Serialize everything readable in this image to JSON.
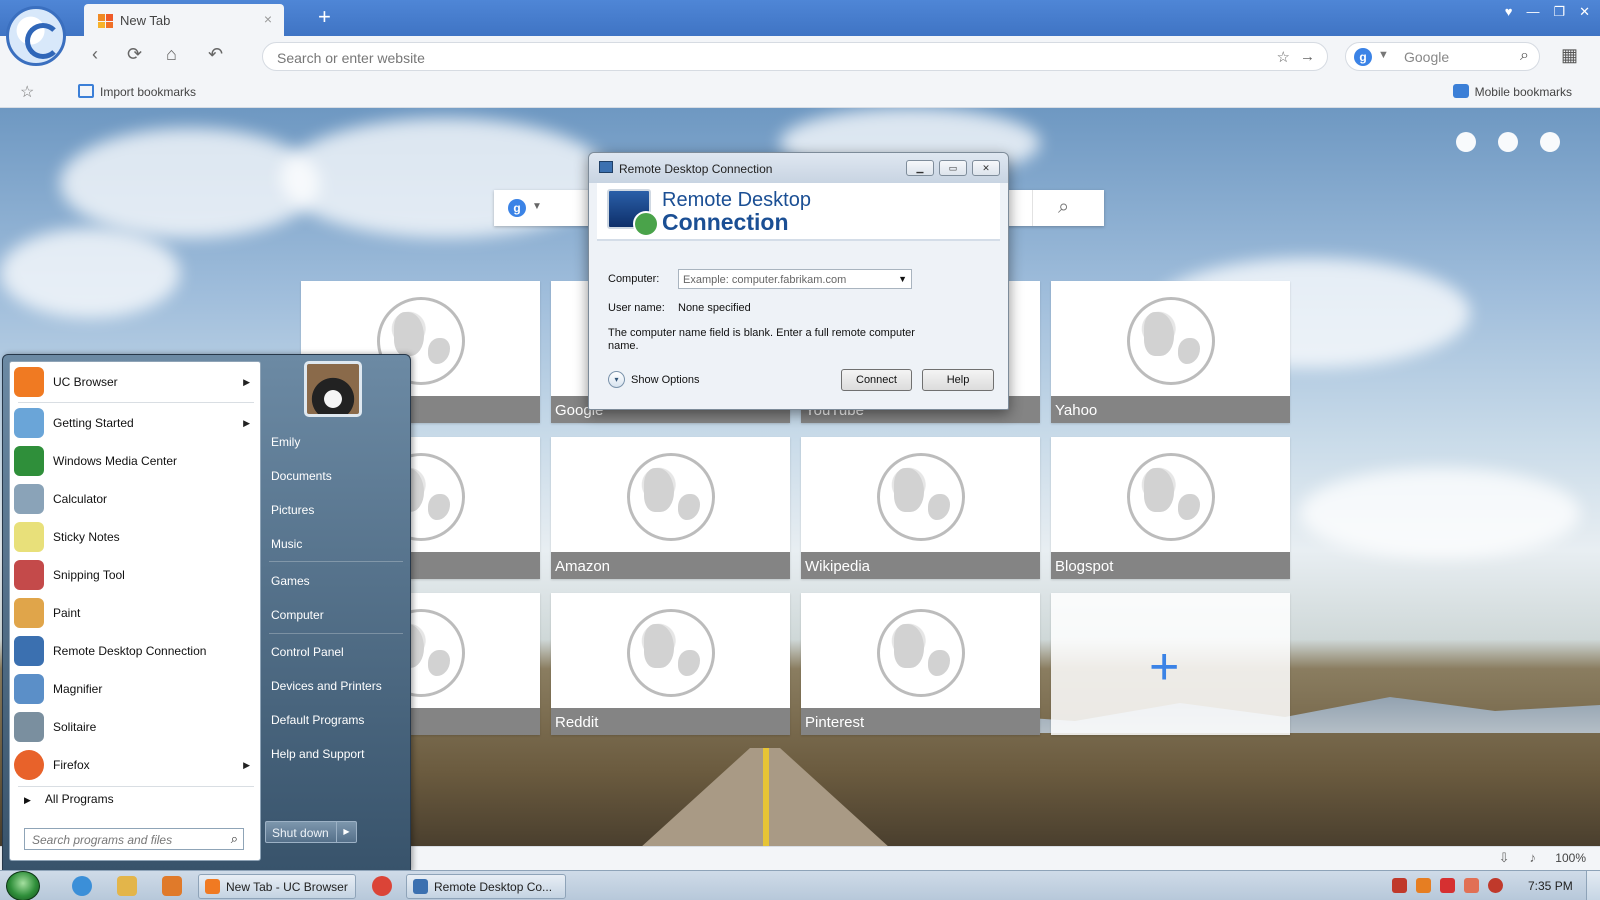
{
  "browser": {
    "tab": {
      "title": "New Tab",
      "close_glyph": "×"
    },
    "new_tab_glyph": "+",
    "window_controls": {
      "minimize": "—",
      "restore": "❐",
      "close": "✕",
      "shirt": "♥"
    },
    "nav": {
      "back": "‹",
      "reload": "⟳",
      "home": "⌂",
      "undo": "↶"
    },
    "address": {
      "placeholder": "Search or enter website",
      "star": "☆",
      "go": "→"
    },
    "search": {
      "engine": "g",
      "placeholder": "Google",
      "icon": "⌕"
    },
    "extensions_glyph": "▦",
    "bookmarks_bar": {
      "star": "☆",
      "import_label": "Import bookmarks",
      "mobile_label": "Mobile bookmarks"
    },
    "status": {
      "zoom": "100%"
    }
  },
  "newtab": {
    "search_engine_badge": "g",
    "search_icon": "⌕",
    "tiles": [
      {
        "label": ""
      },
      {
        "label": "Google"
      },
      {
        "label": "YouTube"
      },
      {
        "label": "Yahoo"
      },
      {
        "label": ""
      },
      {
        "label": "Amazon"
      },
      {
        "label": "Wikipedia"
      },
      {
        "label": "Blogspot"
      },
      {
        "label": ""
      },
      {
        "label": "Reddit"
      },
      {
        "label": "Pinterest"
      }
    ],
    "add_tile_glyph": "+"
  },
  "startmenu": {
    "programs": [
      {
        "label": "UC Browser",
        "icon": "uc-browser-icon",
        "color": "#f07a22",
        "arrow": "▶"
      },
      {
        "label": "Getting Started",
        "icon": "getting-started-icon",
        "color": "#6aa5d8",
        "arrow": "▶"
      },
      {
        "label": "Windows Media Center",
        "icon": "media-center-icon",
        "color": "#2f8f3a",
        "arrow": ""
      },
      {
        "label": "Calculator",
        "icon": "calculator-icon",
        "color": "#8aa3b8",
        "arrow": ""
      },
      {
        "label": "Sticky Notes",
        "icon": "sticky-notes-icon",
        "color": "#e8e07a",
        "arrow": ""
      },
      {
        "label": "Snipping Tool",
        "icon": "snipping-tool-icon",
        "color": "#c44a4a",
        "arrow": ""
      },
      {
        "label": "Paint",
        "icon": "paint-icon",
        "color": "#e0a54a",
        "arrow": ""
      },
      {
        "label": "Remote Desktop Connection",
        "icon": "remote-desktop-icon",
        "color": "#3b70b0",
        "arrow": ""
      },
      {
        "label": "Magnifier",
        "icon": "magnifier-icon",
        "color": "#5b8fc8",
        "arrow": ""
      },
      {
        "label": "Solitaire",
        "icon": "solitaire-icon",
        "color": "#7a8f9f",
        "arrow": ""
      },
      {
        "label": "Firefox",
        "icon": "firefox-icon",
        "color": "#e8622a",
        "arrow": "▶"
      }
    ],
    "all_programs": "All Programs",
    "all_programs_arrow": "▶",
    "search_placeholder": "Search programs and files",
    "search_icon": "⌕",
    "right": [
      {
        "label": "Emily"
      },
      {
        "label": "Documents"
      },
      {
        "label": "Pictures"
      },
      {
        "label": "Music"
      },
      {
        "label": "Games"
      },
      {
        "label": "Computer"
      },
      {
        "label": "Control Panel"
      },
      {
        "label": "Devices and Printers"
      },
      {
        "label": "Default Programs"
      },
      {
        "label": "Help and Support"
      }
    ],
    "shutdown_label": "Shut down",
    "shutdown_arrow": "▶"
  },
  "rdp": {
    "window_title": "Remote Desktop Connection",
    "header_line1": "Remote Desktop",
    "header_line2": "Connection",
    "computer_label": "Computer:",
    "computer_placeholder": "Example: computer.fabrikam.com",
    "username_label": "User name:",
    "username_value": "None specified",
    "message": "The computer name field is blank. Enter a full remote computer name.",
    "show_options": "Show Options",
    "options_glyph": "▾",
    "connect": "Connect",
    "help": "Help",
    "controls": {
      "minimize": "▁",
      "maximize": "▭",
      "close": "✕"
    }
  },
  "taskbar": {
    "tasks": [
      {
        "label": "New Tab - UC Browser",
        "color": "#f07a22"
      },
      {
        "label": "Remote Desktop Co...",
        "color": "#3b70b0"
      }
    ],
    "quick_launch": [
      {
        "icon": "internet-explorer-icon",
        "color": "#3b8fd8"
      },
      {
        "icon": "file-explorer-icon",
        "color": "#e3b54a"
      },
      {
        "icon": "media-player-icon",
        "color": "#e07a2a"
      },
      {
        "icon": "chrome-icon",
        "color": "#db4437"
      }
    ],
    "tray": [
      {
        "icon": "tray-check-icon",
        "color": "#c0392b"
      },
      {
        "icon": "tray-search-icon",
        "color": "#e67e22"
      },
      {
        "icon": "tray-flag-icon",
        "color": "#d63031"
      },
      {
        "icon": "tray-monitor-icon",
        "color": "#e17055"
      },
      {
        "icon": "tray-power-icon",
        "color": "#c0392b"
      }
    ],
    "clock": "7:35 PM"
  }
}
